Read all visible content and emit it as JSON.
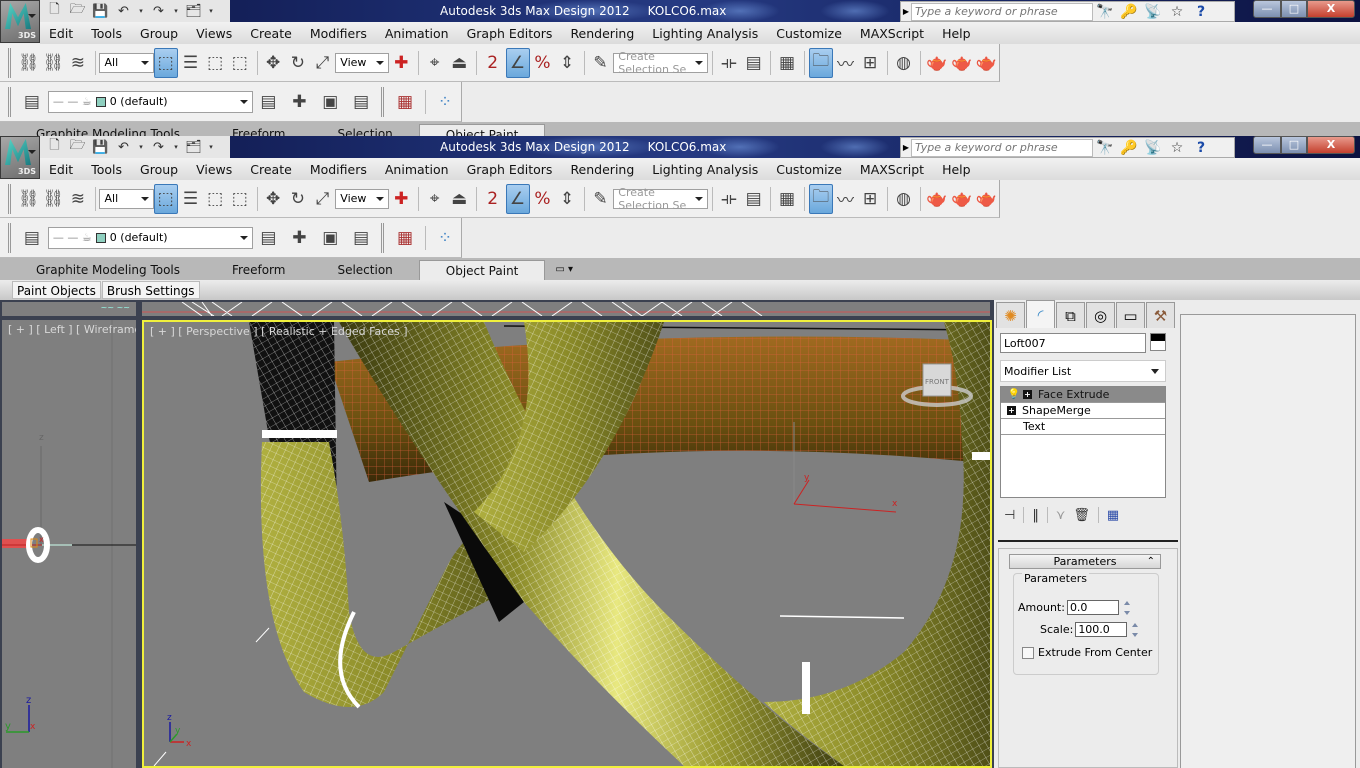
{
  "window": {
    "app_title": "Autodesk 3ds Max Design 2012",
    "file_name": "KOLCO6.max",
    "app_badge": "3DS",
    "search_placeholder": "Type a keyword or phrase",
    "controls": {
      "minimize": "—",
      "maximize": "□",
      "close": "X"
    }
  },
  "quick_access": {
    "icons": [
      "new-file-icon",
      "open-folder-icon",
      "save-icon",
      "undo-icon",
      "redo-icon",
      "project-folder-icon",
      "customize-dropdown-icon"
    ],
    "glyphs": {
      "new": "🗋",
      "open": "🗁",
      "save": "💾",
      "undo": "↶",
      "redo": "↷",
      "project": "🗂",
      "more": "▾"
    }
  },
  "infocenter_icons": {
    "search": "🔍",
    "key": "🔑",
    "satellite": "📡",
    "star": "☆",
    "help": "?"
  },
  "menu": [
    "Edit",
    "Tools",
    "Group",
    "Views",
    "Create",
    "Modifiers",
    "Animation",
    "Graph Editors",
    "Rendering",
    "Lighting Analysis",
    "Customize",
    "MAXScript",
    "Help"
  ],
  "main_toolbar": {
    "selection_filter": "All",
    "reference_coord": "View",
    "named_selection_placeholder": "Create Selection Se",
    "icons": {
      "link": "⛓",
      "unlink": "⛓",
      "bind_space_warp": "≋",
      "select": "⬚",
      "select_by_name": "☰",
      "rect_region": "⬚",
      "window_crossing": "⬚",
      "move": "✥",
      "rotate": "↻",
      "scale": "⤢",
      "pivot": "✚",
      "manipulate": "⌖",
      "keyboard_shortcut": "⏏",
      "snap": "2",
      "angle_snap": "∠",
      "percent_snap": "%",
      "spinner_snap": "⇕",
      "edit_named_sets": "✎",
      "mirror": "⟛",
      "align": "▤",
      "layer_manager": "▦",
      "scene_explorer": "🗀",
      "curve_editor": "〰",
      "schematic": "⊞",
      "material_editor": "◍",
      "render_setup": "🫖",
      "rendered_frame": "🫖",
      "render": "🫖"
    }
  },
  "layer_toolbar": {
    "current_layer": "0 (default)",
    "layer_color": "#8fd0c0"
  },
  "ribbon": {
    "tabs": [
      "Graphite Modeling Tools",
      "Freeform",
      "Selection",
      "Object Paint"
    ],
    "active_tab": "Object Paint",
    "subtabs": [
      "Paint Objects",
      "Brush Settings"
    ]
  },
  "viewports": {
    "left": {
      "label": "[ + ] [ Left ] [ Wireframe ]"
    },
    "perspective": {
      "label": "[ + ] [ Perspective ] [ Realistic + Edged Faces ]",
      "viewcube_face": "FRONT"
    },
    "axis_labels": {
      "x": "x",
      "y": "y",
      "z": "z"
    },
    "active_border_color": "#f0f03c"
  },
  "command_panel": {
    "tabs": [
      "create-tab",
      "modify-tab",
      "hierarchy-tab",
      "motion-tab",
      "display-tab",
      "utilities-tab"
    ],
    "tab_glyphs": [
      "✺",
      "◜",
      "⧉",
      "◎",
      "▭",
      "⚒"
    ],
    "object_name": "Loft007",
    "object_color": "#000000",
    "modifier_list_label": "Modifier List",
    "stack": [
      {
        "name": "Face Extrude",
        "selected": true,
        "has_plus": true,
        "has_bulb": true
      },
      {
        "name": "ShapeMerge",
        "selected": false,
        "has_plus": true,
        "has_bulb": false
      },
      {
        "name": "Text",
        "selected": false,
        "has_plus": false,
        "has_bulb": false
      }
    ],
    "stack_tool_glyphs": {
      "pin": "⊣",
      "show_end": "‖",
      "unique": "⋎",
      "remove": "🗑",
      "configure": "▦"
    },
    "rollout": {
      "title": "Parameters",
      "group_title": "Parameters",
      "amount_label": "Amount:",
      "amount_value": "0.0",
      "scale_label": "Scale:",
      "scale_value": "100.0",
      "extrude_from_center_label": "Extrude From Center",
      "extrude_from_center": false
    }
  }
}
